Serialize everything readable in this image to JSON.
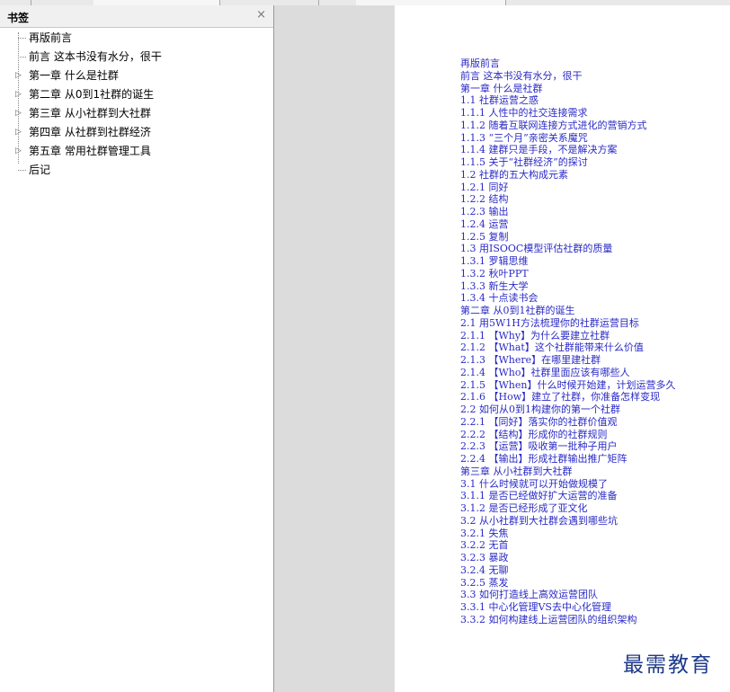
{
  "sidebar": {
    "title": "书签",
    "close_glyph": "×",
    "items": [
      {
        "label": "再版前言",
        "expandable": false
      },
      {
        "label": "前言 这本书没有水分，很干",
        "expandable": false
      },
      {
        "label": "第一章 什么是社群",
        "expandable": true
      },
      {
        "label": "第二章 从0到1社群的诞生",
        "expandable": true
      },
      {
        "label": "第三章 从小社群到大社群",
        "expandable": true
      },
      {
        "label": "第四章 从社群到社群经济",
        "expandable": true
      },
      {
        "label": "第五章 常用社群管理工具",
        "expandable": true
      },
      {
        "label": "后记",
        "expandable": false
      }
    ]
  },
  "document": {
    "toc": [
      "再版前言",
      "前言 这本书没有水分，很干",
      "第一章 什么是社群",
      "1.1 社群运营之惑",
      "1.1.1 人性中的社交连接需求",
      "1.1.2 随着互联网连接方式进化的营销方式",
      "1.1.3 “三个月”亲密关系魔咒",
      "1.1.4 建群只是手段，不是解决方案",
      "1.1.5 关于“社群经济”的探讨",
      "1.2 社群的五大构成元素",
      "1.2.1 同好",
      "1.2.2 结构",
      "1.2.3 输出",
      "1.2.4 运营",
      "1.2.5 复制",
      "1.3 用ISOOC模型评估社群的质量",
      "1.3.1 罗辑思维",
      "1.3.2 秋叶PPT",
      "1.3.3 新生大学",
      "1.3.4 十点读书会",
      "第二章 从0到1社群的诞生",
      "2.1 用5W1H方法梳理你的社群运营目标",
      "2.1.1 【Why】为什么要建立社群",
      "2.1.2 【What】这个社群能带来什么价值",
      "2.1.3 【Where】在哪里建社群",
      "2.1.4 【Who】社群里面应该有哪些人",
      "2.1.5 【When】什么时候开始建，计划运营多久",
      "2.1.6 【How】建立了社群，你准备怎样变现",
      "2.2 如何从0到1构建你的第一个社群",
      "2.2.1 【同好】落实你的社群价值观",
      "2.2.2 【结构】形成你的社群规则",
      "2.2.3 【运营】吸收第一批种子用户",
      "2.2.4 【输出】形成社群输出推广矩阵",
      "第三章 从小社群到大社群",
      "3.1 什么时候就可以开始做规模了",
      "3.1.1 是否已经做好扩大运营的准备",
      "3.1.2 是否已经形成了亚文化",
      "3.2 从小社群到大社群会遇到哪些坑",
      "3.2.1 失焦",
      "3.2.2 无首",
      "3.2.3 暴政",
      "3.2.4 无聊",
      "3.2.5 蒸发",
      "3.3 如何打造线上高效运营团队",
      "3.3.1 中心化管理VS去中心化管理",
      "3.3.2 如何构建线上运营团队的组织架构"
    ],
    "watermark": "最需教育",
    "link_color": "#2a2ac6"
  }
}
